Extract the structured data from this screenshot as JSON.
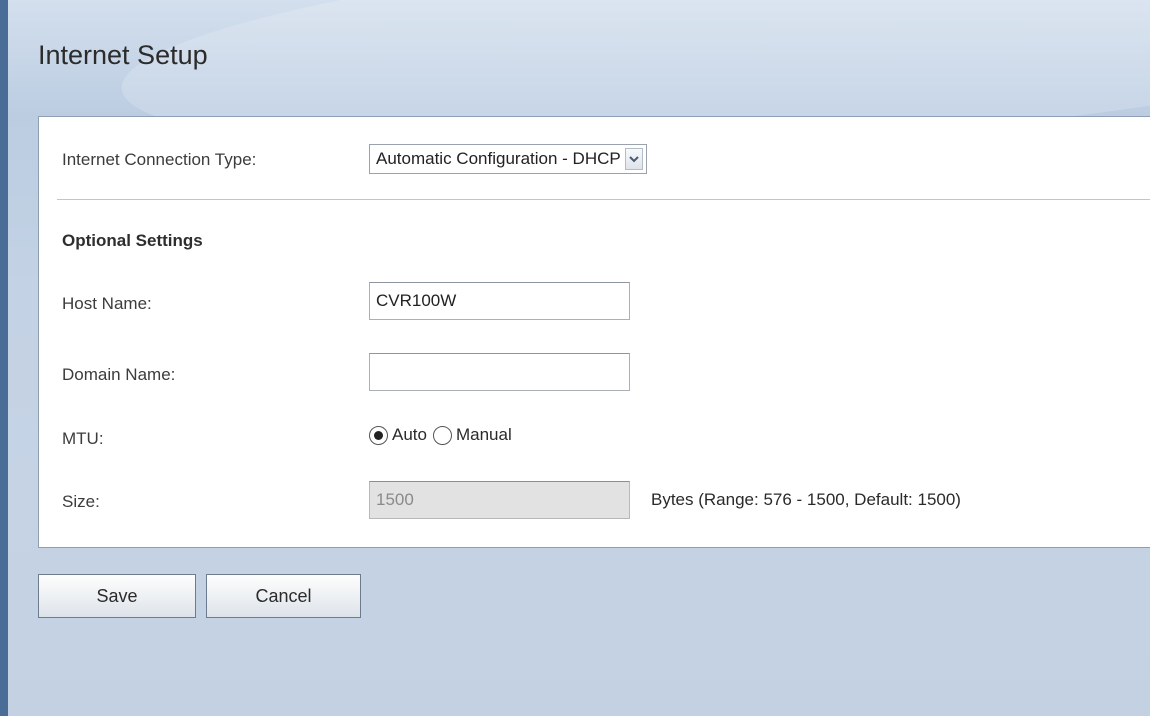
{
  "page": {
    "title": "Internet Setup"
  },
  "connection": {
    "label": "Internet Connection Type:",
    "selected": "Automatic Configuration - DHCP"
  },
  "optional": {
    "heading": "Optional Settings",
    "host_name": {
      "label": "Host Name:",
      "value": "CVR100W"
    },
    "domain_name": {
      "label": "Domain Name:",
      "value": ""
    },
    "mtu": {
      "label": "MTU:",
      "options": [
        "Auto",
        "Manual"
      ],
      "selected": "Auto"
    },
    "size": {
      "label": "Size:",
      "value": "1500",
      "hint": "Bytes (Range: 576 - 1500, Default: 1500)"
    }
  },
  "buttons": {
    "save": "Save",
    "cancel": "Cancel"
  }
}
